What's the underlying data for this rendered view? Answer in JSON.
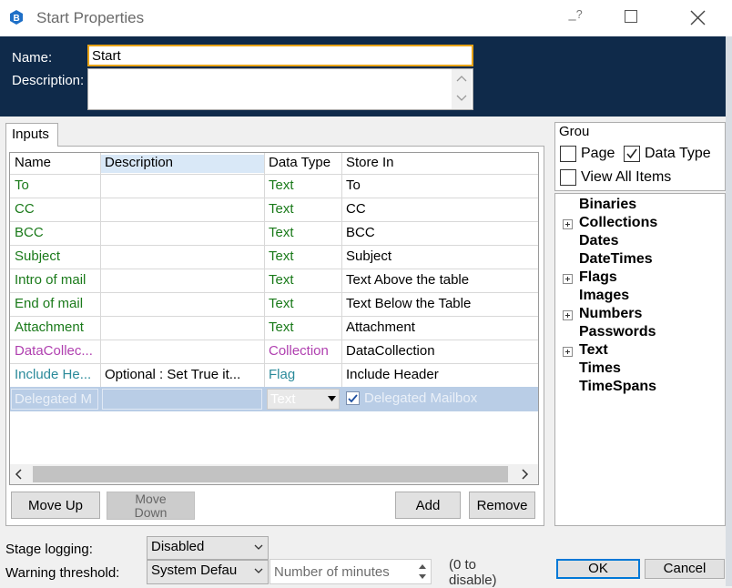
{
  "window": {
    "title": "Start Properties",
    "help_glyph": "?",
    "min_glyph": "–"
  },
  "header": {
    "name_label": "Name:",
    "name_value": "Start",
    "description_label": "Description:",
    "description_value": ""
  },
  "tabs": {
    "inputs_label": "Inputs"
  },
  "table": {
    "columns": [
      "Name",
      "Description",
      "Data Type",
      "Store In"
    ],
    "rows": [
      {
        "name": "To",
        "description": "",
        "type": "Text",
        "store": "To",
        "color": "#1a7a1a"
      },
      {
        "name": "CC",
        "description": "",
        "type": "Text",
        "store": "CC",
        "color": "#1a7a1a"
      },
      {
        "name": "BCC",
        "description": "",
        "type": "Text",
        "store": "BCC",
        "color": "#1a7a1a"
      },
      {
        "name": "Subject",
        "description": "",
        "type": "Text",
        "store": "Subject",
        "color": "#1a7a1a"
      },
      {
        "name": "Intro of mail",
        "description": "",
        "type": "Text",
        "store": "Text Above the table",
        "color": "#1a7a1a"
      },
      {
        "name": "End of mail",
        "description": "",
        "type": "Text",
        "store": "Text Below the Table",
        "color": "#1a7a1a"
      },
      {
        "name": "Attachment",
        "description": "",
        "type": "Text",
        "store": "Attachment",
        "color": "#1a7a1a"
      },
      {
        "name": "DataCollec...",
        "description": "",
        "type": "Collection",
        "store": "DataCollection",
        "color": "#b040b0"
      },
      {
        "name": "Include He...",
        "description": "Optional : Set True it...",
        "type": "Flag",
        "store": "Include Header",
        "color": "#2a8a9a"
      }
    ],
    "selected_row": {
      "name": "Delegated M",
      "description": "",
      "type": "Text",
      "store": "Delegated Mailbox"
    }
  },
  "buttons": {
    "move_up": "Move Up",
    "move_down_line1": "Move",
    "move_down_line2": "Down",
    "add": "Add",
    "remove": "Remove",
    "ok": "OK",
    "cancel": "Cancel"
  },
  "group": {
    "label": "Grou",
    "page_label": "Page",
    "page_checked": false,
    "datatype_label": "Data Type",
    "datatype_checked": true,
    "view_all_label": "View All Items",
    "view_all_checked": false
  },
  "tree": {
    "items": [
      {
        "label": "Binaries",
        "expandable": false
      },
      {
        "label": "Collections",
        "expandable": true
      },
      {
        "label": "Dates",
        "expandable": false
      },
      {
        "label": "DateTimes",
        "expandable": false
      },
      {
        "label": "Flags",
        "expandable": true
      },
      {
        "label": "Images",
        "expandable": false
      },
      {
        "label": "Numbers",
        "expandable": true
      },
      {
        "label": "Passwords",
        "expandable": false
      },
      {
        "label": "Text",
        "expandable": true
      },
      {
        "label": "Times",
        "expandable": false
      },
      {
        "label": "TimeSpans",
        "expandable": false
      }
    ]
  },
  "bottom": {
    "stage_logging_label": "Stage logging:",
    "stage_logging_value": "Disabled",
    "warning_label": "Warning threshold:",
    "warning_value": "System Defau",
    "minutes_placeholder": "Number of minutes",
    "hint_line1": "(0 to",
    "hint_line2": "disable)"
  },
  "colors": {
    "header_bg": "#0f2a4a",
    "focus_border": "#e8a317",
    "selected_row": "#b9cde6",
    "ok_border": "#0078d7"
  }
}
